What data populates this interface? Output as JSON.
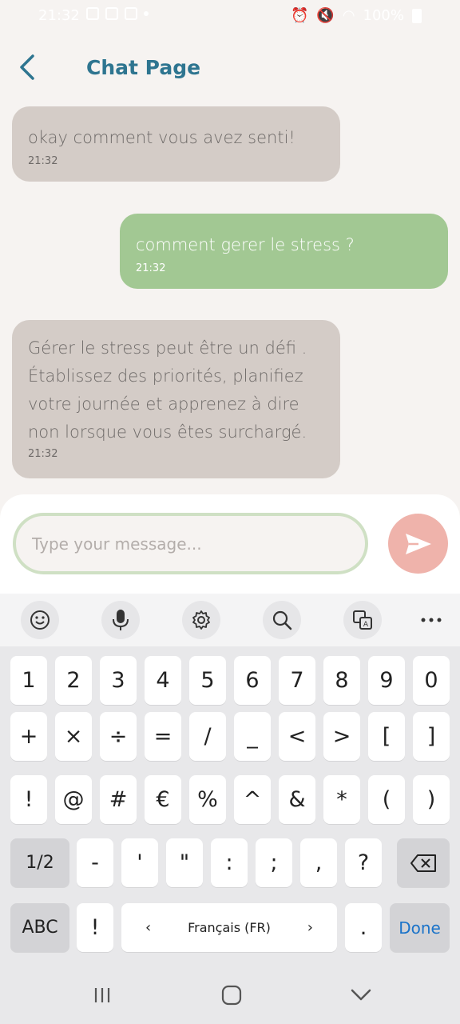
{
  "status_bar": {
    "time": "21:32",
    "battery": "100%"
  },
  "header": {
    "title": "Chat Page",
    "back_icon": "chevron-left-icon"
  },
  "messages": [
    {
      "direction": "in",
      "text": "okay comment vous avez senti!",
      "time": "21:32"
    },
    {
      "direction": "out",
      "text": "comment gerer le stress ?",
      "time": "21:32"
    },
    {
      "direction": "in",
      "text": "Gérer le stress peut être un défi .\nÉtablissez des priorités, planifiez\nvotre journée et apprenez à dire\nnon lorsque vous êtes surchargé.",
      "time": "21:32"
    }
  ],
  "composer": {
    "placeholder": "Type your message...",
    "send_icon": "send-icon"
  },
  "keyboard_toolbar": [
    "emoji-icon",
    "microphone-icon",
    "settings-icon",
    "search-icon",
    "translate-icon",
    "more-icon"
  ],
  "keyboard": {
    "row1": [
      "1",
      "2",
      "3",
      "4",
      "5",
      "6",
      "7",
      "8",
      "9",
      "0"
    ],
    "row2": [
      "+",
      "×",
      "÷",
      "=",
      "/",
      "_",
      "<",
      ">",
      "[",
      "]"
    ],
    "row3": [
      "!",
      "@",
      "#",
      "€",
      "%",
      "^",
      "&",
      "*",
      "(",
      ")"
    ],
    "row4_switch": "1/2",
    "row4": [
      "-",
      "'",
      "\"",
      ":",
      ";",
      ",",
      "?"
    ],
    "abc": "ABC",
    "exclaim": "!",
    "language": "Français (FR)",
    "period": ".",
    "done": "Done"
  },
  "colors": {
    "title": "#2e7590",
    "incoming_bubble": "#d4ccc7",
    "outgoing_bubble": "#a2c893",
    "send_button": "#efb3ab",
    "input_border": "#cfe0c4",
    "done_text": "#1a73c9"
  }
}
